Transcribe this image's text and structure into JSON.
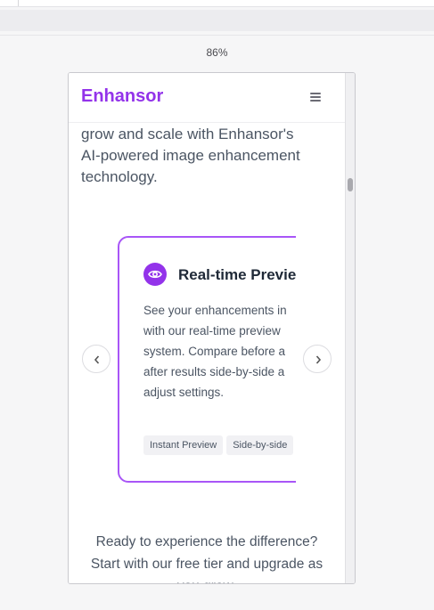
{
  "browser": {
    "zoom_level": "86%"
  },
  "site": {
    "brand": "Enhansor",
    "menu_icon": "hamburger-menu-icon",
    "intro_lines": [
      "grow and scale with Enhansor's",
      "AI-powered image enhancement",
      "technology."
    ],
    "feature_card": {
      "icon": "eye-icon",
      "title": "Real-time Previe",
      "description_lines": [
        "See your enhancements in",
        "with our real-time preview",
        "system. Compare before a",
        "after results side-by-side a",
        "adjust settings."
      ],
      "tags": [
        "Instant Preview",
        "Side-by-side"
      ]
    },
    "carousel": {
      "prev_icon": "chevron-left-icon",
      "next_icon": "chevron-right-icon"
    },
    "cta_lines": [
      "Ready to experience the difference?",
      "Start with our free tier and upgrade as",
      "you grow."
    ],
    "colors": {
      "brand": "#9333ea",
      "card_border": "#a855f7",
      "text": "#4b5563"
    }
  }
}
